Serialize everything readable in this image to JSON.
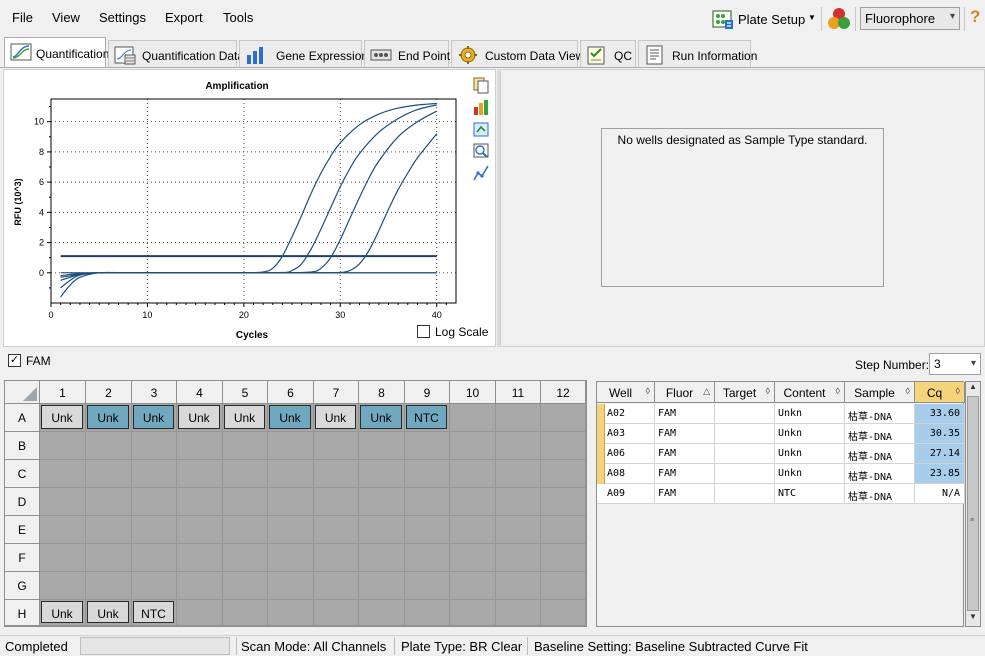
{
  "menu": {
    "file": "File",
    "view": "View",
    "settings": "Settings",
    "export": "Export",
    "tools": "Tools"
  },
  "toolbar": {
    "plate_setup": "Plate Setup",
    "fluorophore": "Fluorophore"
  },
  "tabs": [
    {
      "label": "Quantification",
      "active": true
    },
    {
      "label": "Quantification Data"
    },
    {
      "label": "Gene Expression"
    },
    {
      "label": "End Point"
    },
    {
      "label": "Custom Data View"
    },
    {
      "label": "QC"
    },
    {
      "label": "Run Information"
    }
  ],
  "chart_data": {
    "type": "line",
    "title": "Amplification",
    "xlabel": "Cycles",
    "ylabel": "RFU (10^3)",
    "xlim": [
      0,
      42
    ],
    "ylim": [
      -2,
      11.5
    ],
    "x_ticks": [
      0,
      10,
      20,
      30,
      40
    ],
    "y_ticks": [
      0,
      2,
      4,
      6,
      8,
      10
    ],
    "grid": true,
    "threshold": 1.1,
    "series": [
      {
        "well": "A08",
        "cq": 23.85,
        "x": [
          1,
          2,
          3,
          5,
          8,
          12,
          16,
          20,
          22,
          23,
          24,
          25,
          26,
          27,
          28,
          29,
          30,
          32,
          34,
          36,
          38,
          40
        ],
        "y": [
          -1.6,
          -0.8,
          -0.3,
          0,
          0,
          0,
          0,
          0,
          0.05,
          0.3,
          1.1,
          2.4,
          3.8,
          5.3,
          6.6,
          7.7,
          8.6,
          9.8,
          10.5,
          10.9,
          11.1,
          11.2
        ]
      },
      {
        "well": "A06",
        "cq": 27.14,
        "x": [
          1,
          2,
          3,
          5,
          8,
          12,
          16,
          20,
          24,
          25,
          26,
          27,
          28,
          29,
          30,
          31,
          32,
          34,
          36,
          38,
          40
        ],
        "y": [
          -1.0,
          -0.5,
          -0.15,
          0,
          0,
          0,
          0,
          0,
          0.02,
          0.15,
          0.6,
          1.6,
          2.9,
          4.3,
          5.7,
          6.9,
          7.9,
          9.3,
          10.2,
          10.8,
          11.1
        ]
      },
      {
        "well": "A03",
        "cq": 30.35,
        "x": [
          1,
          2,
          3,
          5,
          8,
          12,
          16,
          20,
          24,
          27,
          28,
          29,
          30,
          31,
          32,
          33,
          34,
          36,
          38,
          40
        ],
        "y": [
          -0.5,
          -0.3,
          -0.1,
          0,
          0,
          0,
          0,
          0,
          0,
          0.05,
          0.3,
          1.0,
          2.2,
          3.6,
          5.0,
          6.3,
          7.4,
          9.0,
          10.0,
          10.7
        ]
      },
      {
        "well": "A02",
        "cq": 33.6,
        "x": [
          1,
          2,
          3,
          5,
          8,
          12,
          16,
          20,
          24,
          28,
          30,
          31,
          32,
          33,
          34,
          35,
          36,
          37,
          38,
          40
        ],
        "y": [
          -0.3,
          -0.2,
          -0.05,
          0,
          0,
          0,
          0,
          0,
          0,
          0,
          0.02,
          0.15,
          0.6,
          1.5,
          2.8,
          4.2,
          5.5,
          6.6,
          7.6,
          9.2
        ]
      },
      {
        "well": "A09",
        "cq": null,
        "x": [
          1,
          2,
          3,
          5,
          8,
          12,
          16,
          20,
          24,
          28,
          32,
          36,
          40
        ],
        "y": [
          -0.2,
          -0.1,
          -0.05,
          0,
          0,
          0,
          0,
          0,
          0,
          0,
          0,
          0,
          0
        ]
      }
    ]
  },
  "chart": {
    "log_scale_label": "Log Scale",
    "log_scale_checked": false
  },
  "std_curve": {
    "message": "No wells designated as Sample Type standard."
  },
  "fluor_filter": {
    "label": "FAM",
    "checked": true,
    "step_label": "Step Number:",
    "step_value": "3"
  },
  "plate": {
    "columns": [
      "1",
      "2",
      "3",
      "4",
      "5",
      "6",
      "7",
      "8",
      "9",
      "10",
      "11",
      "12"
    ],
    "rows": [
      "A",
      "B",
      "C",
      "D",
      "E",
      "F",
      "G",
      "H"
    ],
    "wells": [
      {
        "row": "A",
        "col": 1,
        "label": "Unk",
        "selected": false
      },
      {
        "row": "A",
        "col": 2,
        "label": "Unk",
        "selected": true
      },
      {
        "row": "A",
        "col": 3,
        "label": "Unk",
        "selected": true
      },
      {
        "row": "A",
        "col": 4,
        "label": "Unk",
        "selected": false
      },
      {
        "row": "A",
        "col": 5,
        "label": "Unk",
        "selected": false
      },
      {
        "row": "A",
        "col": 6,
        "label": "Unk",
        "selected": true
      },
      {
        "row": "A",
        "col": 7,
        "label": "Unk",
        "selected": false
      },
      {
        "row": "A",
        "col": 8,
        "label": "Unk",
        "selected": true
      },
      {
        "row": "A",
        "col": 9,
        "label": "NTC",
        "selected": true
      },
      {
        "row": "H",
        "col": 1,
        "label": "Unk",
        "selected": false
      },
      {
        "row": "H",
        "col": 2,
        "label": "Unk",
        "selected": false
      },
      {
        "row": "H",
        "col": 3,
        "label": "NTC",
        "selected": false
      }
    ]
  },
  "table": {
    "headers": [
      "Well",
      "Fluor",
      "Target",
      "Content",
      "Sample",
      "Cq"
    ],
    "rows": [
      {
        "well": "A02",
        "fluor": "FAM",
        "target": "",
        "content": "Unkn",
        "sample": "枯草-DNA",
        "cq": "33.60",
        "highlight": true
      },
      {
        "well": "A03",
        "fluor": "FAM",
        "target": "",
        "content": "Unkn",
        "sample": "枯草-DNA",
        "cq": "30.35",
        "highlight": true
      },
      {
        "well": "A06",
        "fluor": "FAM",
        "target": "",
        "content": "Unkn",
        "sample": "枯草-DNA",
        "cq": "27.14",
        "highlight": true
      },
      {
        "well": "A08",
        "fluor": "FAM",
        "target": "",
        "content": "Unkn",
        "sample": "枯草-DNA",
        "cq": "23.85",
        "highlight": true
      },
      {
        "well": "A09",
        "fluor": "FAM",
        "target": "",
        "content": "NTC",
        "sample": "枯草-DNA",
        "cq": "N/A",
        "highlight": false
      }
    ]
  },
  "status": {
    "state": "Completed",
    "scan_mode": "Scan Mode: All Channels",
    "plate_type": "Plate Type: BR Clear",
    "baseline": "Baseline Setting: Baseline Subtracted Curve Fit"
  },
  "colors": {
    "curve": "#1b4f7d",
    "threshold": "#1e3f66",
    "selected_well": "#6fa8bf",
    "cq_highlight": "#a7cdeb",
    "cq_header": "#f5d37a"
  }
}
